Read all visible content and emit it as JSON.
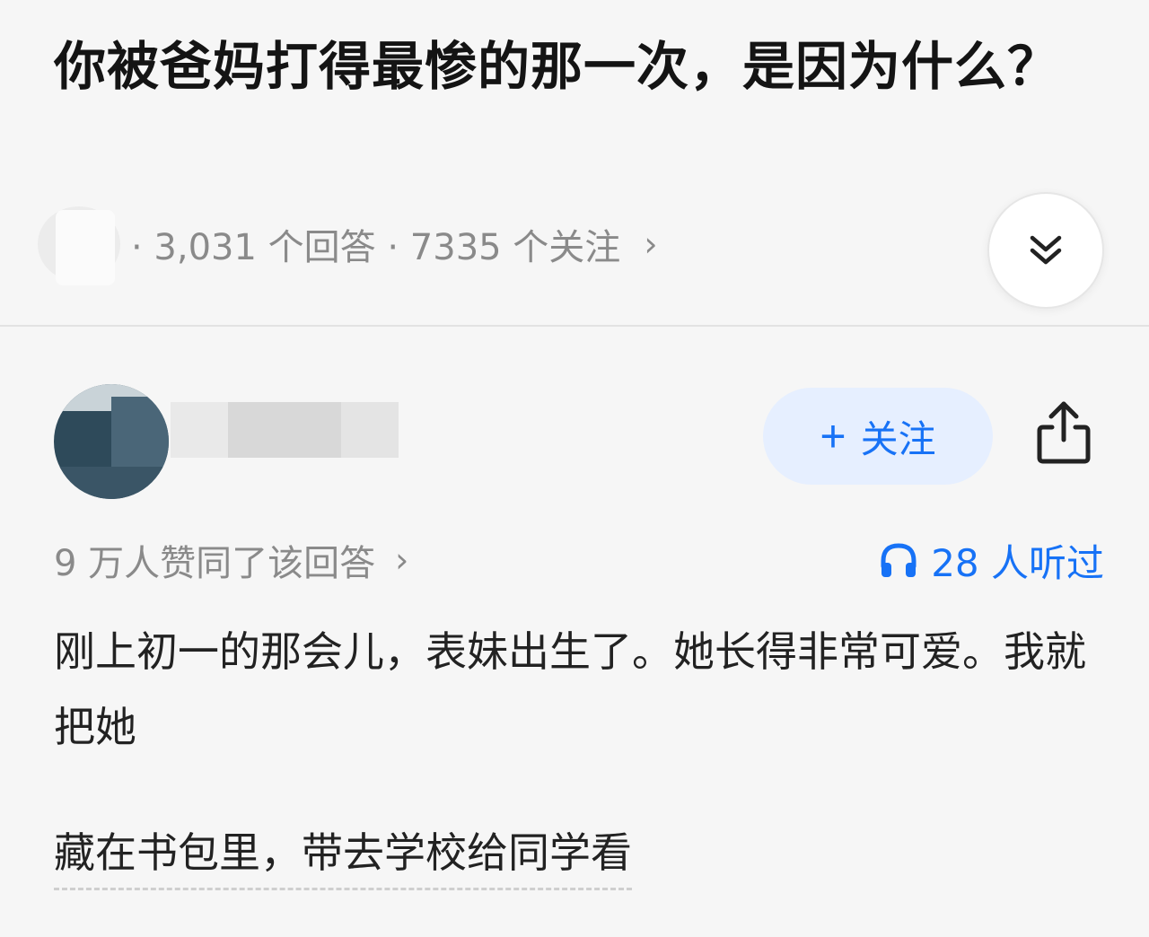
{
  "question": {
    "title": "你被爸妈打得最惨的那一次，是因为什么？",
    "topic_fragment": "…",
    "answer_count_text": "· 3,031 个回答 · 7335 个关注",
    "chevron": "›"
  },
  "author": {
    "follow_icon": "+",
    "follow_label": "关注"
  },
  "stats": {
    "upvote_text": "9 万人赞同了该回答",
    "upvote_chevron": "›",
    "listen_text": "28 人听过"
  },
  "answer": {
    "line1": "刚上初一的那会儿，表妹出生了。她长得非常可爱。我就把她",
    "line2": "藏在书包里，带去学校给同学看"
  },
  "colors": {
    "accent": "#1772f6",
    "follow_bg": "#e6efff",
    "meta_gray": "#8a8a8a",
    "background": "#f6f6f6"
  },
  "icons": {
    "collapse": "double-chevron-down-icon",
    "share": "share-icon",
    "listen": "headphones-icon"
  }
}
